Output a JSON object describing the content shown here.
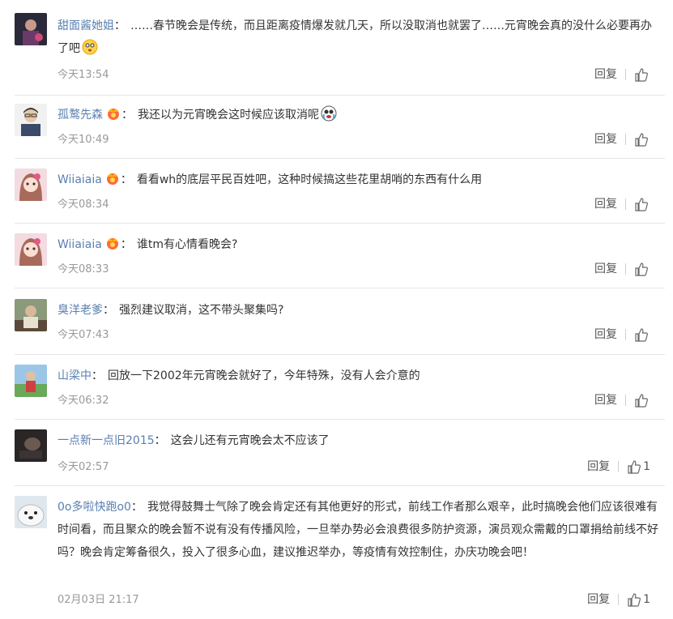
{
  "actions": {
    "reply_label": "回复"
  },
  "comments": [
    {
      "user": "甜面酱她姐",
      "text": "……春节晚会是传统，而且距离疫情爆发就几天，所以没取消也就罢了……元宵晚会真的没什么必要再办了吧",
      "time": "今天13:54",
      "likes": "",
      "avatar": "avatar-dark-figure",
      "badge": false,
      "emoji": "flushed-face-emoji"
    },
    {
      "user": "孤鹜先森",
      "text": "我还以为元宵晚会这时候应该取消呢",
      "time": "今天10:49",
      "likes": "",
      "avatar": "avatar-glasses-man",
      "badge": true,
      "emoji": "crying-face-emoji"
    },
    {
      "user": "Wiiaiaia",
      "text": "看看wh的底层平民百姓吧，这种时候搞这些花里胡哨的东西有什么用",
      "time": "今天08:34",
      "likes": "",
      "avatar": "avatar-anime-girl",
      "badge": true,
      "emoji": ""
    },
    {
      "user": "Wiiaiaia",
      "text": "谁tm有心情看晚会?",
      "time": "今天08:33",
      "likes": "",
      "avatar": "avatar-anime-girl",
      "badge": true,
      "emoji": ""
    },
    {
      "user": "臭洋老爹",
      "text": "强烈建议取消，这不带头聚集吗?",
      "time": "今天07:43",
      "likes": "",
      "avatar": "avatar-old-man",
      "badge": false,
      "emoji": ""
    },
    {
      "user": "山梁中",
      "text": "回放一下2002年元宵晚会就好了，今年特殊，没有人会介意的",
      "time": "今天06:32",
      "likes": "",
      "avatar": "avatar-outdoor-person",
      "badge": false,
      "emoji": ""
    },
    {
      "user": "一点新一点旧2015",
      "text": "这会儿还有元宵晚会太不应该了",
      "time": "今天02:57",
      "likes": "1",
      "avatar": "avatar-dark-photo",
      "badge": false,
      "emoji": ""
    },
    {
      "user": "0o多啦快跑o0",
      "text": "我觉得鼓舞士气除了晚会肯定还有其他更好的形式，前线工作者那么艰辛，此时搞晚会他们应该很难有时间看，而且聚众的晚会暂不说有没有传播风险，一旦举办势必会浪费很多防护资源，演员观众需戴的口罩捐给前线不好吗？晚会肯定筹备很久，投入了很多心血，建议推迟举办，等疫情有效控制住，办庆功晚会吧！",
      "time": "02月03日 21:17",
      "likes": "1",
      "avatar": "avatar-seal",
      "badge": false,
      "emoji": ""
    }
  ]
}
